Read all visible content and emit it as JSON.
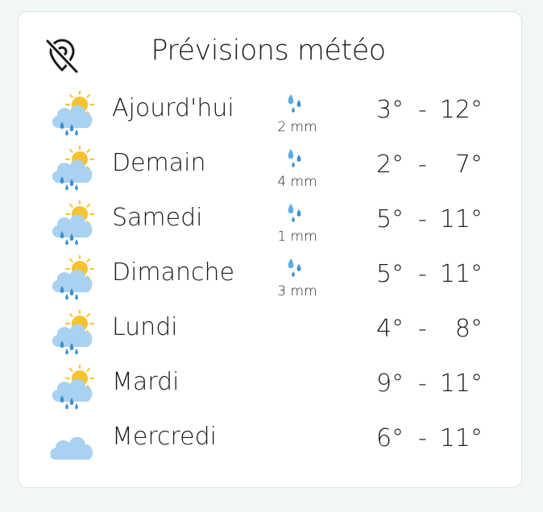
{
  "header": {
    "title": "Prévisions météo",
    "location_icon": "location-off-icon"
  },
  "colors": {
    "cloud": "#a9d2f2",
    "cloud_shadow": "#8ec2ea",
    "sun": "#f6c22e",
    "drop": "#3a8fd1",
    "drop_light": "#59aee6"
  },
  "forecast": [
    {
      "day": "Ajourd'hui",
      "icon": "sun-cloud-rain-icon",
      "rain": "2 mm",
      "tmin": "3°",
      "sep": "-",
      "tmax": "12°"
    },
    {
      "day": "Demain",
      "icon": "sun-cloud-rain-icon",
      "rain": "4 mm",
      "tmin": "2°",
      "sep": "-",
      "tmax": "7°"
    },
    {
      "day": "Samedi",
      "icon": "sun-cloud-rain-icon",
      "rain": "1 mm",
      "tmin": "5°",
      "sep": "-",
      "tmax": "11°"
    },
    {
      "day": "Dimanche",
      "icon": "sun-cloud-rain-icon",
      "rain": "3 mm",
      "tmin": "5°",
      "sep": "-",
      "tmax": "11°"
    },
    {
      "day": "Lundi",
      "icon": "sun-cloud-rain-icon",
      "rain": "",
      "tmin": "4°",
      "sep": "-",
      "tmax": "8°"
    },
    {
      "day": "Mardi",
      "icon": "sun-cloud-rain-icon",
      "rain": "",
      "tmin": "9°",
      "sep": "-",
      "tmax": "11°"
    },
    {
      "day": "Mercredi",
      "icon": "cloud-icon",
      "rain": "",
      "tmin": "6°",
      "sep": "-",
      "tmax": "11°"
    }
  ]
}
